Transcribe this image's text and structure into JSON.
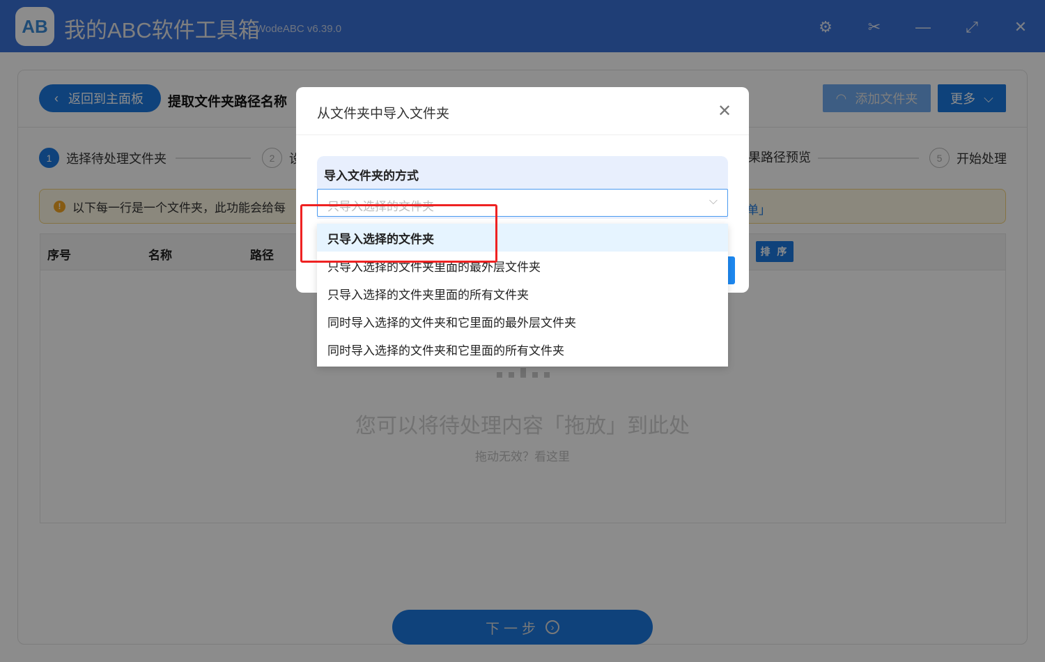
{
  "app": {
    "logo": "AB",
    "title": "我的ABC软件工具箱",
    "version": "WodeABC v6.39.0"
  },
  "window_controls": {
    "settings": "⚙",
    "scissors": "✂",
    "minimize": "—",
    "maximize": "⤢",
    "close": "✕"
  },
  "toolbar": {
    "back": "返回到主面板",
    "back_icon": "‹",
    "page_title": "提取文件夹路径名称",
    "add_folder": "添加文件夹",
    "more": "更多"
  },
  "steps": [
    {
      "num": "1",
      "label": "选择待处理文件夹"
    },
    {
      "num": "2",
      "label": "设"
    },
    {
      "label": "果路径预览"
    },
    {
      "num": "5",
      "label": "开始处理"
    }
  ],
  "notice": {
    "text": "以下每一行是一个文件夹，此功能会给每",
    "link": "单」"
  },
  "table": {
    "columns": [
      "序号",
      "名称",
      "路径"
    ],
    "sort": "排 序"
  },
  "empty": {
    "drop_text": "您可以将待处理内容「拖放」到此处",
    "help": "拖动无效？看这里"
  },
  "next": {
    "label": "下一步",
    "icon": "›"
  },
  "dialog": {
    "title": "从文件夹中导入文件夹",
    "close": "✕",
    "section_label": "导入文件夹的方式",
    "select_placeholder": "只导入选择的文件夹",
    "chevron": "⌵",
    "options": [
      "只导入选择的文件夹",
      "只导入选择的文件夹里面的最外层文件夹",
      "只导入选择的文件夹里面的所有文件夹",
      "同时导入选择的文件夹和它里面的最外层文件夹",
      "同时导入选择的文件夹和它里面的所有文件夹"
    ],
    "selected_index": 0
  },
  "colors": {
    "primary": "#1d78e0",
    "highlight": "#ee2222"
  }
}
